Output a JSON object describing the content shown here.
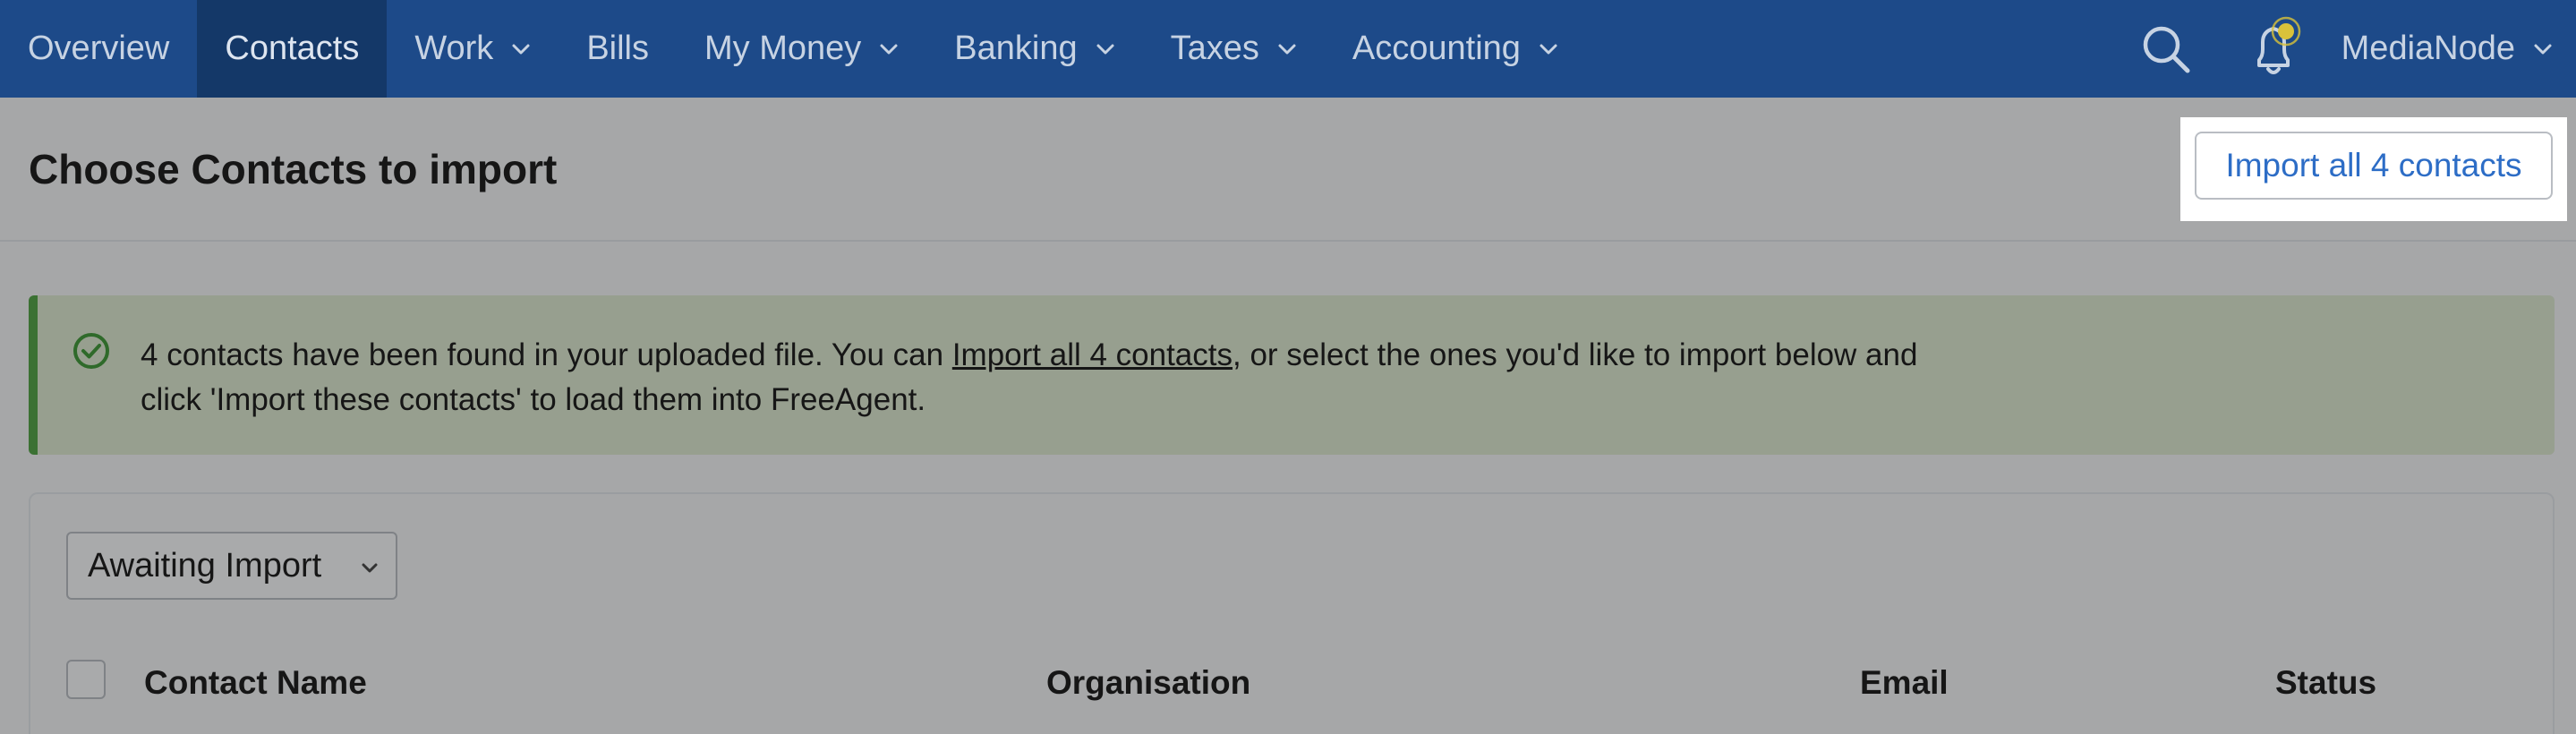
{
  "nav": {
    "items": [
      {
        "label": "Overview"
      },
      {
        "label": "Contacts"
      },
      {
        "label": "Work"
      },
      {
        "label": "Bills"
      },
      {
        "label": "My Money"
      },
      {
        "label": "Banking"
      },
      {
        "label": "Taxes"
      },
      {
        "label": "Accounting"
      }
    ],
    "active": "Contacts",
    "user": "MediaNode",
    "icons": [
      "search-icon",
      "bell-icon",
      "chevron-down-icon"
    ]
  },
  "header": {
    "title": "Choose Contacts to import",
    "import_button": "Import all 4 contacts"
  },
  "alert": {
    "text_before": "4 contacts have been found in your uploaded file. You can ",
    "link": "Import all 4 contacts",
    "text_after": ", or select the ones you'd like to import below and click 'Import these contacts' to load them into FreeAgent.",
    "icon": "check-circle-icon"
  },
  "filter": {
    "selected": "Awaiting Import"
  },
  "table": {
    "columns": [
      "Contact Name",
      "Organisation",
      "Email",
      "Status"
    ]
  },
  "colors": {
    "nav_bg": "#1d4a89",
    "nav_active_bg": "#143868",
    "link_blue": "#2d6dc6",
    "alert_bg": "#979f8f",
    "alert_border": "#3b7133",
    "notification_dot": "#d9c23a"
  }
}
